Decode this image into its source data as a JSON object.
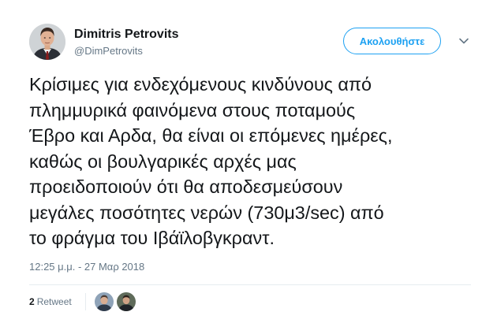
{
  "tweet": {
    "author": {
      "name": "Dimitris Petrovits",
      "handle": "@DimPetrovits"
    },
    "follow_label": "Ακολουθήστε",
    "text_lines": [
      "Κρίσιμες για ενδεχόμενους κινδύνους από",
      "πλημμυρικά φαινόμενα στους ποταμούς",
      "Έβρο και Αρδα, θα είναι οι επόμενες ημέρες,",
      "καθώς οι βουλγαρικές αρχές μας",
      "προειδοποιούν ότι θα αποδεσμεύσουν",
      "μεγάλες ποσότητες νερών (730μ3/sec) από",
      "το φράγμα του Ιβάϊλοβγκραντ."
    ],
    "timestamp": "12:25 μ.μ. - 27 Μαρ 2018",
    "stats": {
      "retweet_count": "2",
      "retweet_label": "Retweet"
    },
    "icons": {
      "caret": "chevron-down-icon"
    },
    "colors": {
      "accent": "#1da1f2",
      "text": "#14171a",
      "secondary": "#657786",
      "divider": "#e6ecf0"
    }
  }
}
